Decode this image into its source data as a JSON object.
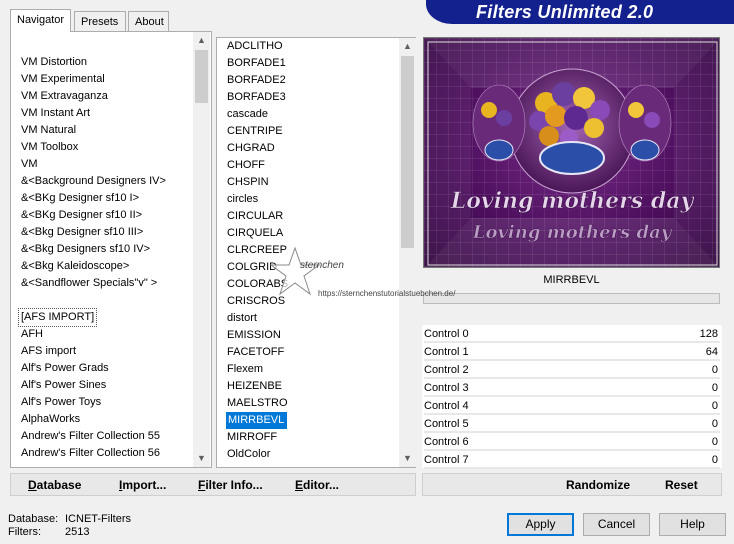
{
  "window": {
    "banner_title": "Filters Unlimited 2.0"
  },
  "tabs": [
    {
      "label": "Navigator",
      "active": true
    },
    {
      "label": "Presets",
      "active": false
    },
    {
      "label": "About",
      "active": false
    }
  ],
  "categories": [
    "VM Distortion",
    "VM Experimental",
    "VM Extravaganza",
    "VM Instant Art",
    "VM Natural",
    "VM Toolbox",
    "VM",
    "&<Background Designers IV>",
    "&<BKg Designer sf10 I>",
    "&<BKg Designer sf10 II>",
    "&<Bkg Designer sf10 III>",
    "&<Bkg Designers sf10 IV>",
    "&<Bkg Kaleidoscope>",
    "&<Sandflower Specials\"v\" >",
    "",
    "[AFS IMPORT]",
    "AFH",
    "AFS import",
    "Alf's Power Grads",
    "Alf's Power Sines",
    "Alf's Power Toys",
    "AlphaWorks",
    "Andrew's Filter Collection 55",
    "Andrew's Filter Collection 56"
  ],
  "filters": [
    "ADCLITHO",
    "BORFADE1",
    "BORFADE2",
    "BORFADE3",
    "cascade",
    "CENTRIPE",
    "CHGRAD",
    "CHOFF",
    "CHSPIN",
    "circles",
    "CIRCULAR",
    "CIRQUELA",
    "CLRCREEP",
    "COLGRID",
    "COLORABS",
    "CRISCROS",
    "distort",
    "EMISSION",
    "FACETOFF",
    "Flexem",
    "HEIZENBE",
    "MAELSTRO",
    "MIRRBEVL",
    "MIRROFF",
    "OldColor"
  ],
  "selected_filter": "MIRRBEVL",
  "preview": {
    "caption_line1": "Loving mothers day",
    "caption_line2": "Loving mothers day"
  },
  "controls": [
    {
      "label": "Control 0",
      "value": "128"
    },
    {
      "label": "Control 1",
      "value": "64"
    },
    {
      "label": "Control 2",
      "value": "0"
    },
    {
      "label": "Control 3",
      "value": "0"
    },
    {
      "label": "Control 4",
      "value": "0"
    },
    {
      "label": "Control 5",
      "value": "0"
    },
    {
      "label": "Control 6",
      "value": "0"
    },
    {
      "label": "Control 7",
      "value": "0"
    }
  ],
  "toolbar": {
    "database_ul": "D",
    "database_rest": "atabase",
    "import_ul": "I",
    "import_rest": "mport...",
    "filterinfo_ul": "F",
    "filterinfo_rest": "ilter Info...",
    "editor_ul": "E",
    "editor_rest": "ditor...",
    "randomize": "Randomize",
    "reset": "Reset"
  },
  "status": {
    "database_label": "Database:",
    "database_value": "ICNET-Filters",
    "filters_label": "Filters:",
    "filters_value": "2513"
  },
  "buttons": {
    "apply": "Apply",
    "cancel": "Cancel",
    "help": "Help"
  },
  "watermark": {
    "name": "sternchen",
    "url": "https://sternchenstutorialstuebchen.de/"
  },
  "colors": {
    "banner": "#13218f",
    "selection": "#0078d7",
    "preview_bg": "#4d0f5e"
  }
}
